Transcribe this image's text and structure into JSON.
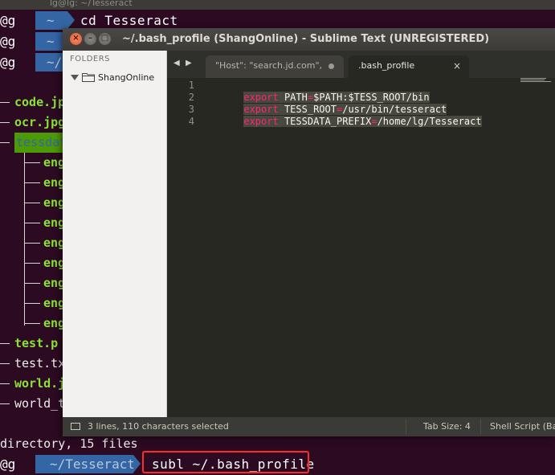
{
  "terminal": {
    "titlebar": "lg@lg: ~/Tesseract",
    "prompt_user": "@g",
    "prompt_dir_partial": "~",
    "prompts": [
      {
        "user": "@g",
        "dir": "~",
        "cmd": "cd Tesseract"
      },
      {
        "user": "@g",
        "dir": "~",
        "cmd": ""
      },
      {
        "user": "@g",
        "dir": "~/",
        "cmd": ""
      }
    ],
    "tree": [
      {
        "name": "code.jpg",
        "style": "green",
        "depth": 0
      },
      {
        "name": "ocr.jpg",
        "style": "green",
        "depth": 0
      },
      {
        "name": "tessdata",
        "style": "hl",
        "depth": 0
      },
      {
        "name": "eng",
        "style": "green",
        "depth": 1
      },
      {
        "name": "eng",
        "style": "green",
        "depth": 1
      },
      {
        "name": "eng",
        "style": "green",
        "depth": 1
      },
      {
        "name": "eng",
        "style": "green",
        "depth": 1
      },
      {
        "name": "eng",
        "style": "green",
        "depth": 1
      },
      {
        "name": "eng",
        "style": "green",
        "depth": 1
      },
      {
        "name": "eng",
        "style": "green",
        "depth": 1
      },
      {
        "name": "eng",
        "style": "green",
        "depth": 1
      },
      {
        "name": "eng",
        "style": "green",
        "depth": 1
      },
      {
        "name": "test.p",
        "style": "green",
        "depth": 0
      },
      {
        "name": "test.tx",
        "style": "white",
        "depth": 0
      },
      {
        "name": "world.j",
        "style": "green",
        "depth": 0
      },
      {
        "name": "world_t",
        "style": "white",
        "depth": 0
      }
    ],
    "summary": "directory, 15 files",
    "last_prompt": {
      "user": "@g",
      "dir": "~/Tesseract",
      "cmd": "subl ~/.bash_profile"
    }
  },
  "sublime": {
    "window_title": "~/.bash_profile (ShangOnline) - Sublime Text (UNREGISTERED)",
    "window_buttons": {
      "close": "×",
      "minimize": "–",
      "maximize": "□"
    },
    "sidebar": {
      "header": "FOLDERS",
      "folder": "ShangOnline"
    },
    "tab_nav": {
      "prev": "◀",
      "next": "▶"
    },
    "tabs": [
      {
        "label": "\"Host\": \"search.jd.com\",",
        "active": false,
        "dirty": true
      },
      {
        "label": ".bash_profile",
        "active": true,
        "close": "×"
      }
    ],
    "editor": {
      "line_numbers": [
        "1",
        "2",
        "3",
        "4"
      ],
      "lines": [
        {
          "kw": "export",
          "sep": " ",
          "name": "PATH",
          "eq": "=",
          "value": "$PATH:$TESS_ROOT/bin"
        },
        {
          "kw": "export",
          "sep": " ",
          "name": "TESS_ROOT",
          "eq": "=",
          "value": "/usr/bin/tesseract"
        },
        {
          "kw": "export",
          "sep": " ",
          "name": "TESSDATA_PREFIX",
          "eq": "=",
          "value": "/home/lg/Tesseract"
        },
        {
          "kw": "",
          "sep": "",
          "name": "",
          "eq": "",
          "value": ""
        }
      ]
    },
    "statusbar": {
      "selection": "3 lines, 110 characters selected",
      "tab_size": "Tab Size: 4",
      "syntax": "Shell Script (Bas"
    }
  },
  "colors": {
    "terminal_bg": "#2c0a22",
    "prompt_dir_bg": "#3465a4",
    "highlight_box": "#ff2a2a",
    "keyword": "#f92672",
    "editor_bg": "#272822"
  }
}
